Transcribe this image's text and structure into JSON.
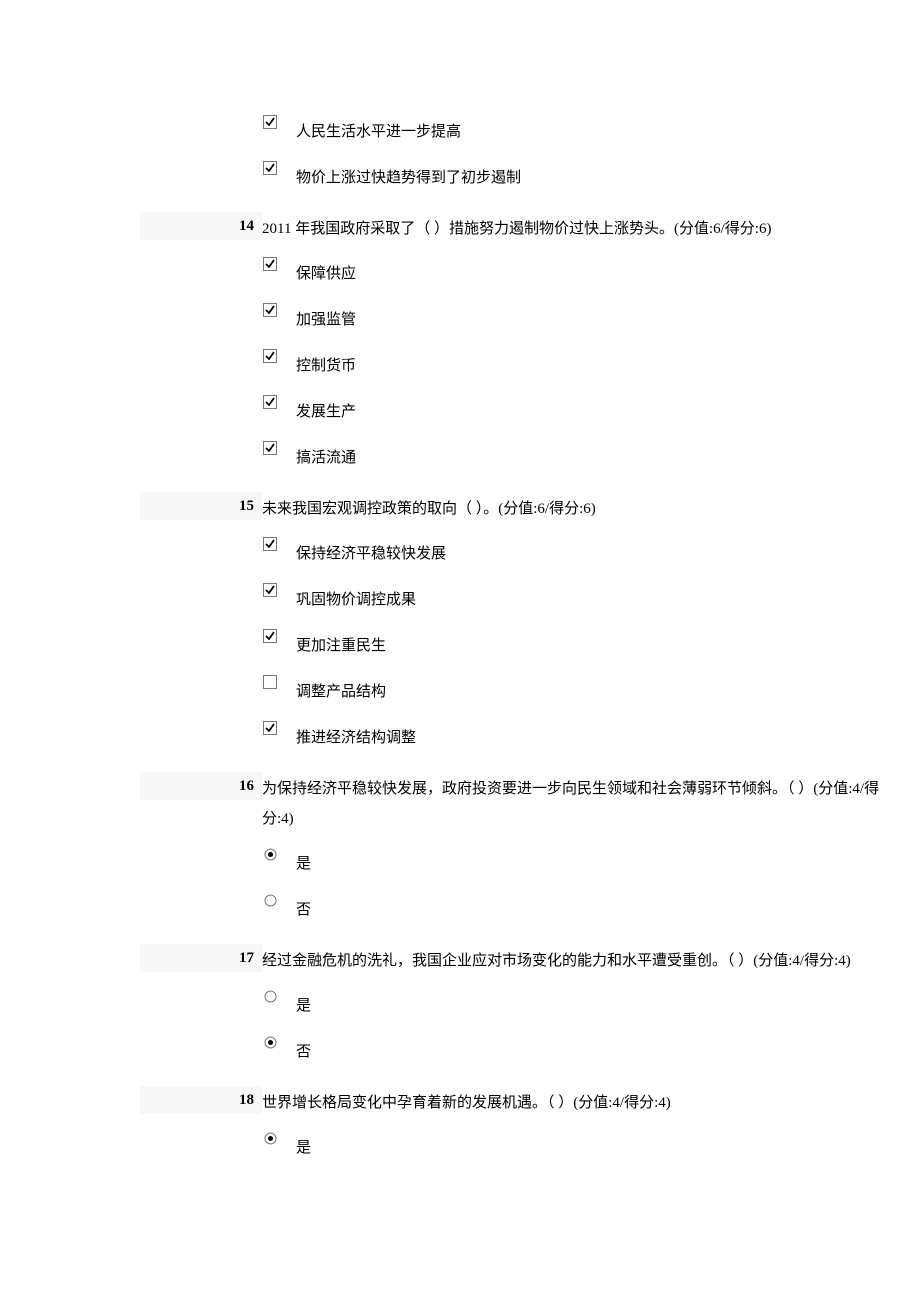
{
  "q13_extra": {
    "options": [
      {
        "checked": true,
        "label": "人民生活水平进一步提高"
      },
      {
        "checked": true,
        "label": "物价上涨过快趋势得到了初步遏制"
      }
    ]
  },
  "q14": {
    "num": "14",
    "text": "2011 年我国政府采取了（ ）措施努力遏制物价过快上涨势头。(分值:6/得分:6)",
    "options": [
      {
        "checked": true,
        "label": "保障供应"
      },
      {
        "checked": true,
        "label": "加强监管"
      },
      {
        "checked": true,
        "label": "控制货币"
      },
      {
        "checked": true,
        "label": "发展生产"
      },
      {
        "checked": true,
        "label": "搞活流通"
      }
    ]
  },
  "q15": {
    "num": "15",
    "text": "未来我国宏观调控政策的取向（ ）。(分值:6/得分:6)",
    "options": [
      {
        "checked": true,
        "label": "保持经济平稳较快发展"
      },
      {
        "checked": true,
        "label": "巩固物价调控成果"
      },
      {
        "checked": true,
        "label": "更加注重民生"
      },
      {
        "checked": false,
        "label": "调整产品结构"
      },
      {
        "checked": true,
        "label": "推进经济结构调整"
      }
    ]
  },
  "q16": {
    "num": "16",
    "text": "为保持经济平稳较快发展，政府投资要进一步向民生领域和社会薄弱环节倾斜。（ ）(分值:4/得分:4)",
    "options": [
      {
        "selected": true,
        "label": "是"
      },
      {
        "selected": false,
        "label": "否"
      }
    ]
  },
  "q17": {
    "num": "17",
    "text": "经过金融危机的洗礼，我国企业应对市场变化的能力和水平遭受重创。（ ）(分值:4/得分:4)",
    "options": [
      {
        "selected": false,
        "label": "是"
      },
      {
        "selected": true,
        "label": "否"
      }
    ]
  },
  "q18": {
    "num": "18",
    "text": "世界增长格局变化中孕育着新的发展机遇。（ ）(分值:4/得分:4)",
    "options": [
      {
        "selected": true,
        "label": "是"
      }
    ]
  }
}
